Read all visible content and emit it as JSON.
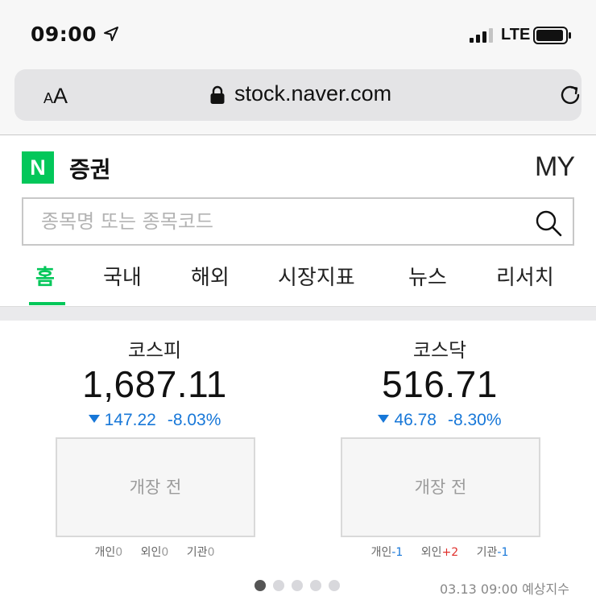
{
  "status_bar": {
    "time": "09:00",
    "network": "LTE"
  },
  "browser": {
    "text_size_small": "A",
    "text_size_large": "A",
    "url": "stock.naver.com"
  },
  "header": {
    "logo": "N",
    "site_name": "증권",
    "my_label": "MY"
  },
  "search": {
    "placeholder": "종목명 또는 종목코드"
  },
  "tabs": [
    {
      "label": "홈",
      "active": true
    },
    {
      "label": "국내",
      "active": false
    },
    {
      "label": "해외",
      "active": false
    },
    {
      "label": "시장지표",
      "active": false
    },
    {
      "label": "뉴스",
      "active": false
    },
    {
      "label": "리서치",
      "active": false
    }
  ],
  "indices": [
    {
      "name": "코스피",
      "value": "1,687.11",
      "change": "147.22",
      "change_pct": "-8.03%",
      "chart_label": "개장 전",
      "investors": [
        {
          "label": "개인",
          "value": "0"
        },
        {
          "label": "외인",
          "value": "0"
        },
        {
          "label": "기관",
          "value": "0"
        }
      ]
    },
    {
      "name": "코스닥",
      "value": "516.71",
      "change": "46.78",
      "change_pct": "-8.30%",
      "chart_label": "개장 전",
      "investors": [
        {
          "label": "개인",
          "value": "-1"
        },
        {
          "label": "외인",
          "value": "+2"
        },
        {
          "label": "기관",
          "value": "-1"
        }
      ]
    }
  ],
  "pager": {
    "count": 5,
    "active_index": 0
  },
  "footer_note": "03.13 09:00 예상지수",
  "colors": {
    "brand_green": "#03c75a",
    "down_blue": "#1777d8",
    "up_red": "#e0302c"
  }
}
